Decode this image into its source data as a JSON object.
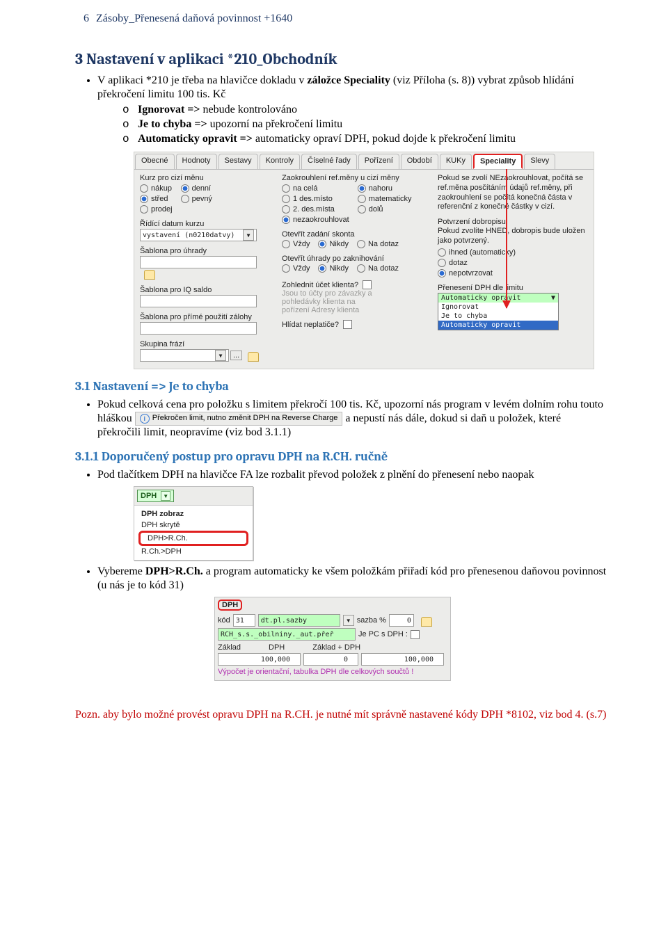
{
  "header": {
    "page": "6",
    "title": "Zásoby_Přenesená daňová povinnost +1640"
  },
  "section3": {
    "title": "3 Nastavení v aplikaci *210_Obchodník",
    "text1a": "V aplikaci *210 je třeba na hlavičce dokladu v ",
    "text1b_bold": "záložce Speciality",
    "text1c": " (viz Příloha (s. 8)) vybrat způsob hlídání překročení limitu 100 tis. Kč",
    "opt1_b": "Ignorovat =>",
    "opt1_r": " nebude kontrolováno",
    "opt2_b": "Je to chyba =>",
    "opt2_r": " upozorní na překročení limitu",
    "opt3_b": "Automaticky opravit =>",
    "opt3_r": " automaticky opraví DPH, pokud dojde k překročení limitu"
  },
  "shot1": {
    "tabs": [
      "Obecné",
      "Hodnoty",
      "Sestavy",
      "Kontroly",
      "Číselné řady",
      "Pořízení",
      "Období",
      "KUKy",
      "Speciality",
      "Slevy"
    ],
    "colA": {
      "g1": "Kurz pro cizí měnu",
      "g1opts": {
        "nakup": "nákup",
        "stred": "střed",
        "prodej": "prodej",
        "denni": "denní",
        "pevny": "pevný"
      },
      "lbl_ridici": "Řídící datum kurzu",
      "fld_ridici": "vystavení (n0210datvy)",
      "lbl_sab1": "Šablona pro úhrady",
      "lbl_sab2": "Šablona pro IQ saldo",
      "lbl_sab3": "Šablona pro přímé použití zálohy",
      "lbl_skup": "Skupina frází"
    },
    "colB": {
      "g2": "Zaokrouhlení ref.měny u cizí měny",
      "left": {
        "nacela": "na celá",
        "des1": "1 des.místo",
        "des2": "2. des.místa",
        "nez": "nezaokrouhlovat"
      },
      "right": {
        "nahoru": "nahoru",
        "mat": "matematicky",
        "dolu": "dolů"
      },
      "lbl_sk": "Otevřít zadání skonta",
      "lbl_uh": "Otevřít úhrady po zaknihování",
      "vzdy": "Vždy",
      "nikdy": "Nikdy",
      "nadotaz": "Na dotaz",
      "lbl_zoh": "Zohlednit účet klienta?",
      "pale1": "Jsou to účty pro závazky a",
      "pale2": "pohledávky klienta na",
      "pale3": "pořízení Adresy klienta",
      "lbl_nep": "Hlídat neplatiče?"
    },
    "colC": {
      "note": "Pokud se zvolí NEzaokrouhlovat, počítá se ref.měna posčítáním údajů ref.měny, při zaokrouhlení se počítá konečná částa v referenční z konečné částky v cizí.",
      "lbl_pot": "Potvrzení dobropisu",
      "pot_note": "Pokud zvolíte HNED, dobropis bude uložen jako potvrzený.",
      "ihned": "ihned (automaticky)",
      "dotaz": "dotaz",
      "nepot": "nepotvrzovat",
      "lbl_pren": "Přenesení DPH dle limitu",
      "dd_current": "Automaticky opravit",
      "dd_opts": [
        "Ignorovat",
        "Je to chyba",
        "Automaticky opravit"
      ]
    }
  },
  "section31": {
    "title": "3.1 Nastavení => Je to chyba",
    "t1": "Pokud celková cena pro položku s limitem překročí 100 tis. Kč, upozorní nás  program v levém dolním rohu touto hláškou ",
    "info": "Překročen limit, nutno změnit DPH na Reverse Charge",
    "t2": " a nepustí nás dále, dokud si daň u položek, které překročili limit, neopravíme (viz bod 3.1.1)"
  },
  "section311": {
    "title": "3.1.1 Doporučený postup pro opravu DPH na R.CH. ručně",
    "p1": "Pod tlačítkem DPH na hlavičce FA lze rozbalit převod položek z plnění do přenesení nebo naopak",
    "menu": {
      "btn": "DPH",
      "row1": "DPH zobraz",
      "row2": "DPH skrytě",
      "row3": "DPH>R.Ch.",
      "row4": "R.Ch.>DPH"
    },
    "p2a": "Vybereme ",
    "p2b": "DPH>R.Ch.",
    "p2c": " a program automaticky ke všem položkám přiřadí kód pro přenesenou daňovou povinnost (u nás je to kód 31)",
    "panel": {
      "hdr": "DPH",
      "kod_lbl": "kód",
      "kod": "31",
      "pl": "dt.pl.sazby",
      "sazba_lbl": "sazba %",
      "sazba": "0",
      "desc": "RCH_s.s._obilniny._aut.přeř",
      "jepc": "Je PC s DPH :",
      "zaklad": "Základ",
      "dph": "DPH",
      "zadph": "Základ + DPH",
      "v1": "100,000",
      "v2": "0",
      "v3": "100,000",
      "foot": "Výpočet je orientační, tabulka DPH dle celkových součtů !"
    }
  },
  "footnote": "Pozn. aby bylo možné provést opravu DPH na R.CH. je nutné mít správně nastavené kódy DPH *8102, viz bod 4. (s.7)"
}
